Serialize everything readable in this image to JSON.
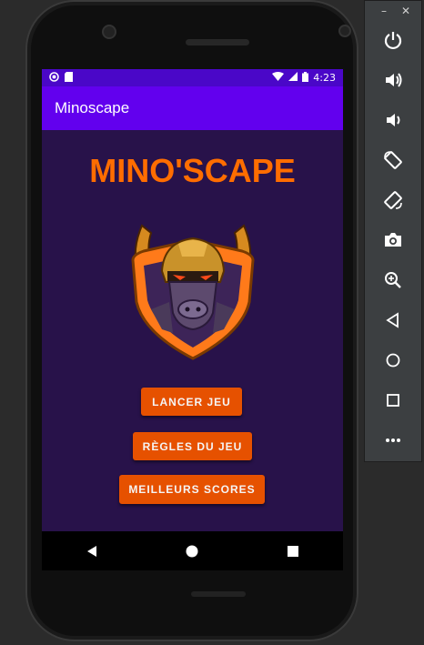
{
  "statusbar": {
    "time": "4:23"
  },
  "appbar": {
    "title": "Minoscape"
  },
  "main": {
    "game_title": "MINO'SCAPE",
    "buttons": {
      "start": "LANCER JEU",
      "rules": "RÈGLES DU JEU",
      "scores": "MEILLEURS SCORES"
    }
  },
  "emulator": {
    "window_controls": {
      "minimize": "–",
      "close": "✕"
    },
    "toolbar_icons": [
      "power-icon",
      "volume-up-icon",
      "volume-down-icon",
      "rotate-left-icon",
      "rotate-right-icon",
      "camera-icon",
      "zoom-icon",
      "back-icon",
      "home-icon",
      "overview-icon",
      "more-icon"
    ]
  },
  "colors": {
    "accent": "#ff6d00",
    "button": "#e65100",
    "appbar": "#6200ee",
    "statusbar": "#4a07c8",
    "background": "#28124a"
  }
}
